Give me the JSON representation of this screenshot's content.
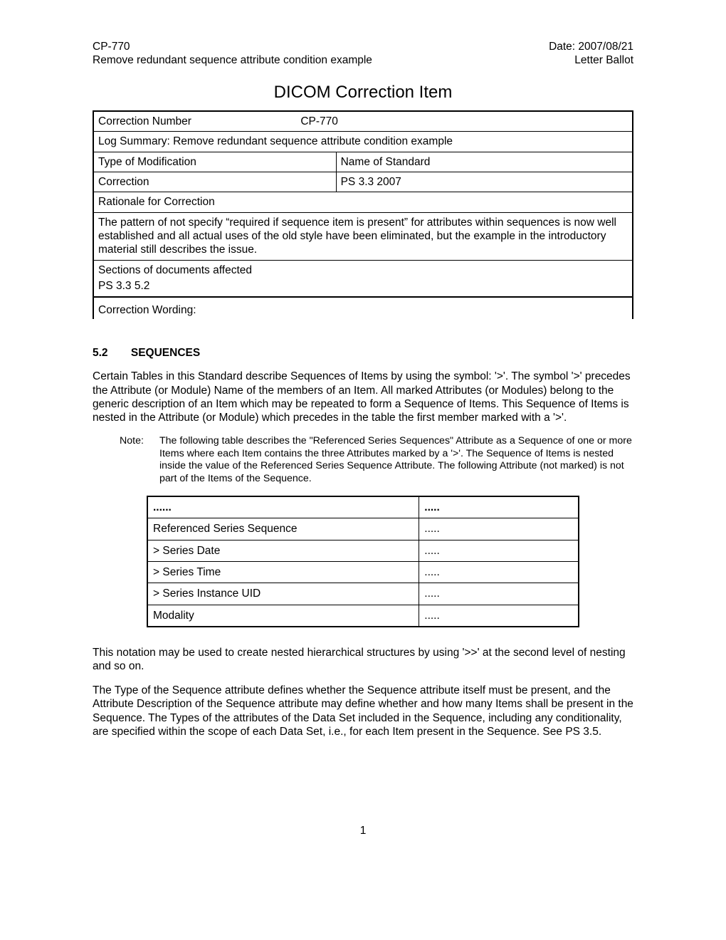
{
  "header": {
    "left1": "CP-770",
    "right1": "Date: 2007/08/21",
    "left2": "Remove redundant sequence attribute condition example",
    "right2": "Letter Ballot"
  },
  "title": "DICOM Correction Item",
  "info": {
    "correction_number_label": "Correction Number",
    "correction_number_value": "CP-770",
    "log_summary": "Log Summary: Remove redundant sequence attribute condition example",
    "type_of_mod_label": "Type of Modification",
    "name_of_standard_label": "Name of Standard",
    "type_of_mod_value": "Correction",
    "name_of_standard_value": "PS 3.3 2007",
    "rationale_label": "Rationale for Correction",
    "rationale_text": "The pattern of not specify “required if sequence item is present” for attributes within sequences is now well established and all actual uses of the old style have been eliminated, but the example in the introductory material still describes the issue.",
    "sections_affected_label": "Sections of documents affected",
    "sections_affected_value": "PS 3.3 5.2",
    "correction_wording_label": "Correction Wording:"
  },
  "section": {
    "num": "5.2",
    "title": "SEQUENCES",
    "para1": "Certain Tables in this Standard describe Sequences of Items by using the symbol: '>'. The symbol '>' precedes the Attribute (or Module) Name of the members of an Item. All marked Attributes (or Modules) belong to the generic description of an Item which may be repeated to form a Sequence of Items. This Sequence of Items is nested in the Attribute (or Module) which precedes in the table the first member marked with a '>'.",
    "note_label": "Note:",
    "note_text": "The following table describes the \"Referenced Series Sequences\" Attribute as a Sequence of one or more Items where each Item contains the three Attributes marked by a '>'. The Sequence of Items is nested inside the value of the Referenced Series Sequence Attribute. The following Attribute (not marked) is not part of the Items of the Sequence.",
    "para2": "This notation may be used to create nested hierarchical structures by using '>>' at the second level of nesting and so on.",
    "para3": "The Type of the Sequence attribute defines whether the Sequence attribute itself must be present, and the Attribute Description of the Sequence attribute may define whether and how many Items shall be present in the Sequence.  The Types of the attributes of the Data Set included in the Sequence, including any conditionality, are specified within the scope of each Data Set, i.e., for each Item present in the Sequence.  See PS 3.5."
  },
  "seq_table": {
    "rows": [
      {
        "c1": "......",
        "c2": "....."
      },
      {
        "c1": "Referenced Series Sequence",
        "c2": "....."
      },
      {
        "c1": "> Series Date",
        "c2": "....."
      },
      {
        "c1": "> Series Time",
        "c2": "....."
      },
      {
        "c1": "> Series Instance UID",
        "c2": "....."
      },
      {
        "c1": "Modality",
        "c2": "....."
      }
    ]
  },
  "page_num": "1"
}
